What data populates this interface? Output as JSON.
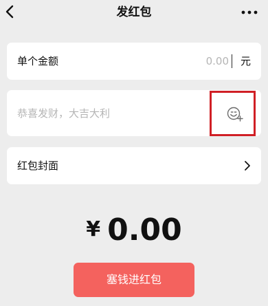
{
  "header": {
    "title": "发红包"
  },
  "amount_row": {
    "label": "单个金额",
    "placeholder": "0.00",
    "unit": "元"
  },
  "greeting_row": {
    "placeholder": "恭喜发财，大吉大利"
  },
  "cover_row": {
    "label": "红包封面"
  },
  "total": {
    "currency": "¥",
    "amount": "0.00"
  },
  "submit": {
    "label": "塞钱进红包"
  },
  "colors": {
    "background": "#ededed",
    "card": "#ffffff",
    "button": "#f4625e",
    "highlight_box": "#d01f25",
    "placeholder_text": "#b5b5b5"
  }
}
